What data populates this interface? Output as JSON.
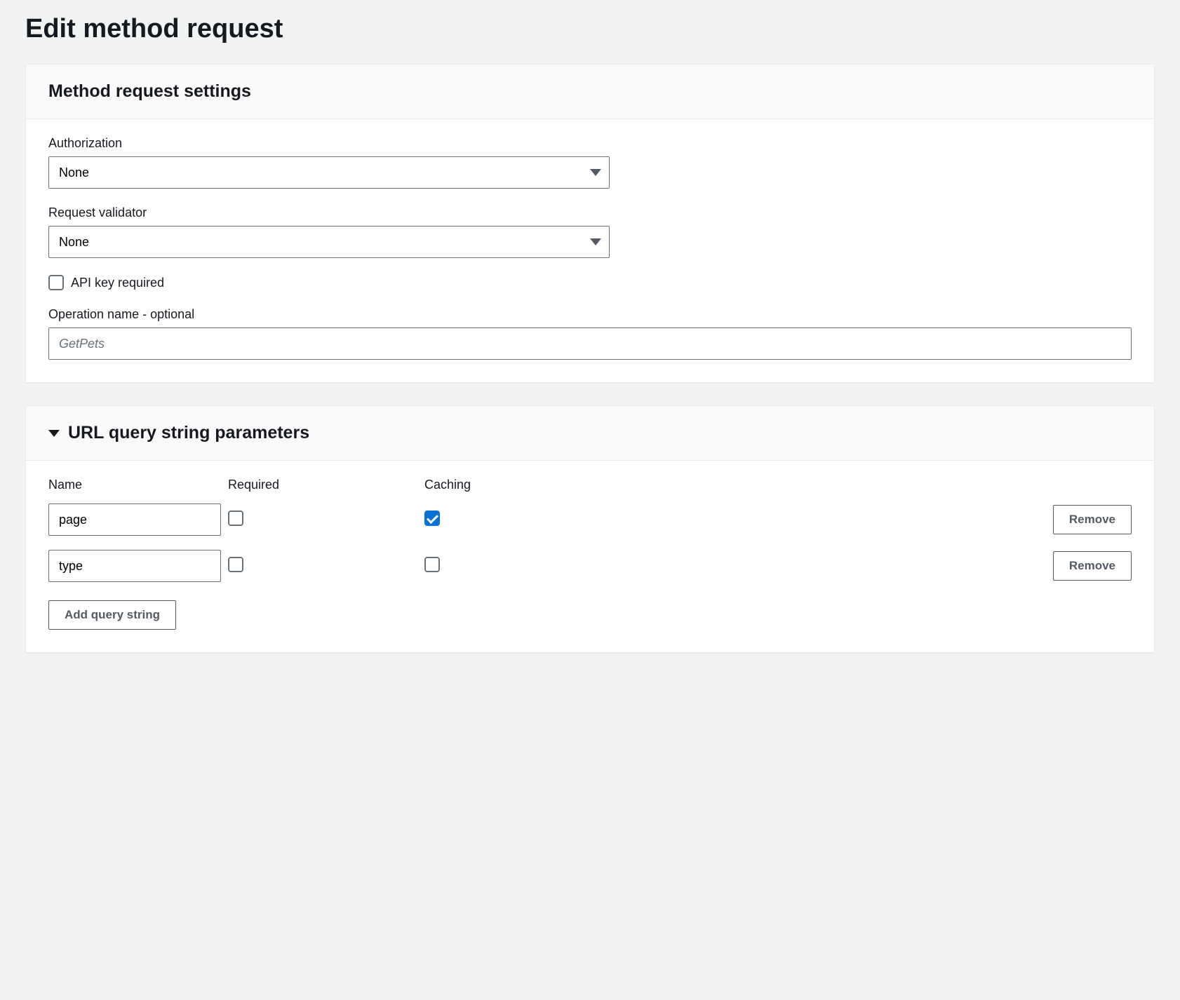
{
  "page": {
    "title": "Edit method request"
  },
  "settings_panel": {
    "title": "Method request settings",
    "authorization": {
      "label": "Authorization",
      "value": "None"
    },
    "request_validator": {
      "label": "Request validator",
      "value": "None"
    },
    "api_key": {
      "label": "API key required",
      "checked": false
    },
    "operation_name": {
      "label": "Operation name - optional",
      "value": "",
      "placeholder": "GetPets"
    }
  },
  "query_params_panel": {
    "title": "URL query string parameters",
    "headers": {
      "name": "Name",
      "required": "Required",
      "caching": "Caching"
    },
    "rows": [
      {
        "name": "page",
        "required": false,
        "caching": true
      },
      {
        "name": "type",
        "required": false,
        "caching": false
      }
    ],
    "remove_label": "Remove",
    "add_label": "Add query string"
  }
}
